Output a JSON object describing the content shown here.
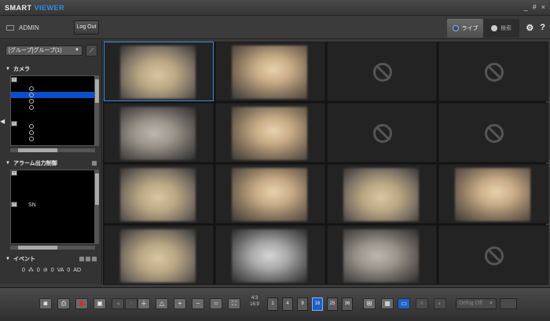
{
  "titlebar": {
    "brand_part1": "SMART",
    "brand_part2": "VIEWER",
    "minimize": "_",
    "maximize": "#",
    "close": "×"
  },
  "header": {
    "user": "ADMIN",
    "logout_label": "Log Out",
    "tabs": [
      {
        "label": "ライブ",
        "active": true
      },
      {
        "label": "検索",
        "active": false
      }
    ],
    "settings_icon": "⚙",
    "help_icon": "?"
  },
  "sidebar": {
    "group_select_value": "[グループ]グループ(1)",
    "camera_section": "カメラ",
    "alarm_section": "アラーム出力制御",
    "alarm_node_label": "SN",
    "event_section": "イベント",
    "event_counts": [
      "0",
      "0",
      "0",
      "0",
      "0",
      "0"
    ],
    "event_labels": [
      "",
      "",
      "",
      "VA",
      "AD"
    ]
  },
  "grid": {
    "columns": 4,
    "rows": 4,
    "cells": [
      {
        "type": "video",
        "variant": "v1",
        "active": true
      },
      {
        "type": "video",
        "variant": "v3"
      },
      {
        "type": "no-video"
      },
      {
        "type": "no-video"
      },
      {
        "type": "video",
        "variant": "v2"
      },
      {
        "type": "video",
        "variant": "v3"
      },
      {
        "type": "no-video"
      },
      {
        "type": "no-video"
      },
      {
        "type": "video",
        "variant": "v1"
      },
      {
        "type": "video",
        "variant": "v3"
      },
      {
        "type": "video",
        "variant": "v1"
      },
      {
        "type": "video",
        "variant": "v3"
      },
      {
        "type": "video",
        "variant": "v1"
      },
      {
        "type": "video",
        "variant": "v4"
      },
      {
        "type": "video",
        "variant": "v2"
      },
      {
        "type": "no-video"
      }
    ]
  },
  "toolbar": {
    "split_nav_top": "4:3",
    "split_nav_bottom": "16:9",
    "split_options": [
      "1",
      "4",
      "9",
      "16",
      "25",
      "36"
    ],
    "split_selected": "16",
    "defog_value": "Defog Off"
  }
}
